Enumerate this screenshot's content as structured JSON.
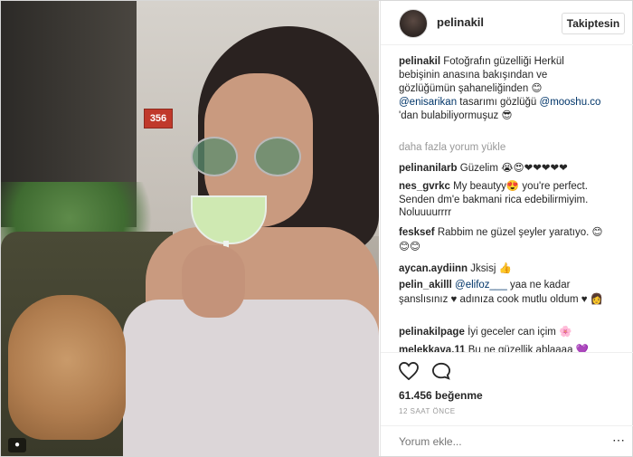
{
  "photo": {
    "door_number": "356"
  },
  "header": {
    "username": "pelinakil",
    "follow_label": "Takipte­sin"
  },
  "caption": {
    "user": "pelinakil",
    "text_line1": "Fotoğrafın güzelliği Herkül",
    "text_line2": "bebişinin anasına bakışından ve",
    "text_line3": "gözlüğümün şahaneliğinden",
    "emoji1": "😊",
    "mention1": "@enisarikan",
    "text_line4": "tasarımı gözlüğü",
    "mention2": "@mooshu.co",
    "text_line5": "'dan bulabiliyormuşuz",
    "emoji2": "😎"
  },
  "load_more": "daha fazla yorum yükle",
  "comments": [
    {
      "user": "pelinanilarb",
      "text": "Güzelim",
      "emoji": "😭😍❤❤❤❤❤"
    },
    {
      "user": "nes_gvrkc",
      "text": "My beautyy😍 you're perfect. Senden dm'e bakmani rica edebilirmiyim. Noluuuurrrr"
    },
    {
      "user": "fesksef",
      "text": "Rabbim ne güzel şeyler yaratıyo.",
      "emoji": "😊 😊😊"
    },
    {
      "user": "aycan.aydiinn",
      "text": "Jksisj",
      "emoji": "👍"
    },
    {
      "user": "pelin_akilll",
      "mention": "@elifoz___",
      "text": "yaa ne kadar şanslısınız ♥ adınıza cook mutlu oldum ♥",
      "emoji": "👩"
    },
    {
      "user": "pelinakilpage",
      "text": "İyi geceler can içim",
      "emoji": "🌸"
    },
    {
      "user": "melekkaya.11",
      "text": "Bu ne güzellik ablaaaa",
      "emoji": "💜"
    }
  ],
  "stats": {
    "likes": "61.456 beğenme",
    "time_ago": "12 SAAT ÖNCE"
  },
  "add_comment": {
    "placeholder": "Yorum ekle..."
  },
  "icons": {
    "like": "heart-icon",
    "comment": "comment-icon",
    "more": "more-options-icon",
    "camera": "camera-icon"
  },
  "colors": {
    "mention": "#003569",
    "muted": "#999999",
    "text": "#262626"
  }
}
